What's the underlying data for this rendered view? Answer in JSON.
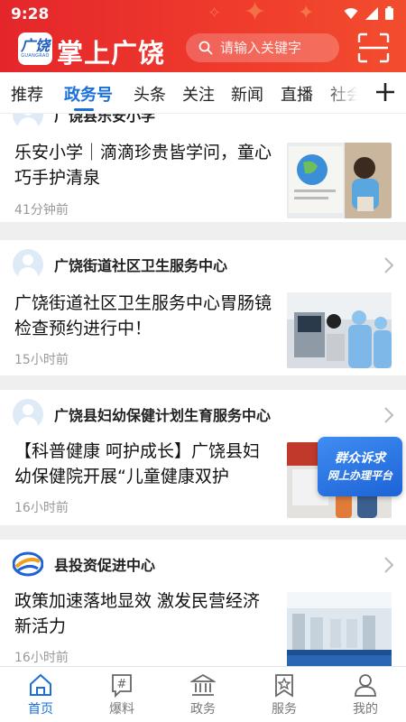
{
  "status_bar": {
    "time": "9:28"
  },
  "header": {
    "logo_text": "广饶",
    "logo_sub": "GUANGRAO",
    "app_name": "掌上广饶",
    "search_placeholder": "请输入关键字"
  },
  "tabs": [
    {
      "label": "推荐",
      "active": false
    },
    {
      "label": "政务号",
      "active": true
    },
    {
      "label": "头条",
      "active": false
    },
    {
      "label": "关注",
      "active": false
    },
    {
      "label": "新闻",
      "active": false
    },
    {
      "label": "直播",
      "active": false
    },
    {
      "label": "社会",
      "active": false
    }
  ],
  "feed": [
    {
      "source": "广饶县乐安小学",
      "title": "乐安小学｜滴滴珍贵皆学问，童心巧手护清泉",
      "time": "41分钟前"
    },
    {
      "source": "广饶街道社区卫生服务中心",
      "title": "广饶街道社区卫生服务中心胃肠镜检查预约进行中！",
      "time": "15小时前"
    },
    {
      "source": "广饶县妇幼保健计划生育服务中心",
      "title": "【科普健康 呵护成长】广饶县妇幼保健院开展“儿童健康双护",
      "time": "16小时前"
    },
    {
      "source": "县投资促进中心",
      "title": "政策加速落地显效 激发民营经济新活力",
      "time": "16小时前"
    }
  ],
  "floating_banner": {
    "line1": "群众诉求",
    "line2": "网上办理平台"
  },
  "bottom_nav": [
    {
      "label": "首页",
      "icon": "home-icon",
      "active": true
    },
    {
      "label": "爆料",
      "icon": "hashtag-icon",
      "active": false
    },
    {
      "label": "政务",
      "icon": "government-icon",
      "active": false
    },
    {
      "label": "服务",
      "icon": "service-icon",
      "active": false
    },
    {
      "label": "我的",
      "icon": "user-icon",
      "active": false
    }
  ],
  "colors": {
    "brand_red": "#e4262b",
    "accent_blue": "#1a6fd8",
    "muted_text": "#999999"
  }
}
